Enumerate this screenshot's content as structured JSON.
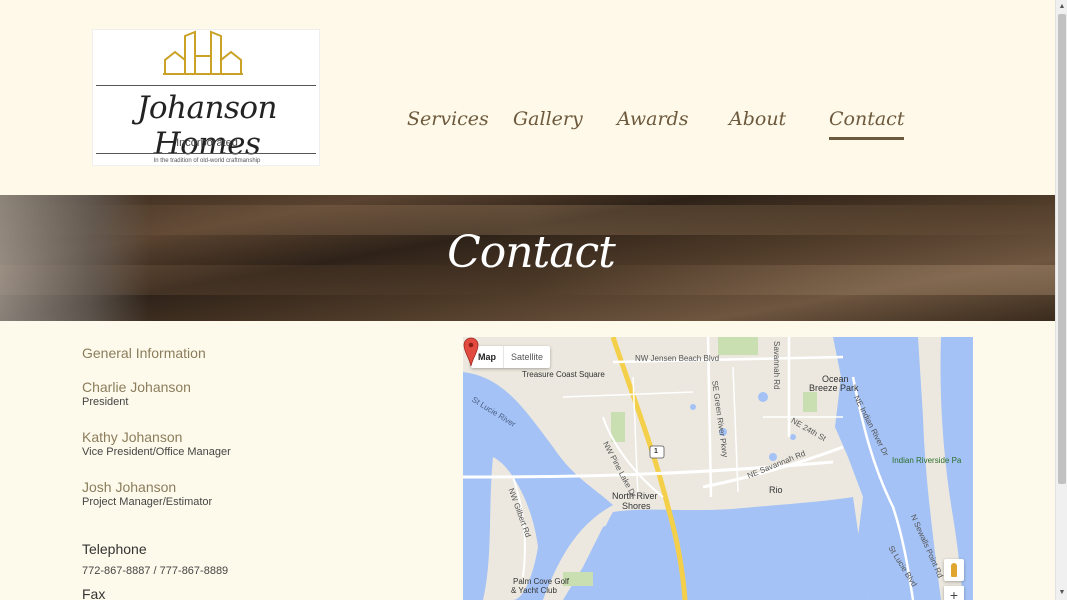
{
  "logo": {
    "brand": "Johanson Homes",
    "incorporated": "Incorporated",
    "tagline": "In the tradition of old-world craftmanship"
  },
  "nav": {
    "items": [
      {
        "label": "Services"
      },
      {
        "label": "Gallery"
      },
      {
        "label": "Awards"
      },
      {
        "label": "About"
      },
      {
        "label": "Contact",
        "active": true
      }
    ]
  },
  "banner": {
    "title": "Contact"
  },
  "contact": {
    "general_title": "General Information",
    "people": [
      {
        "name": "Charlie Johanson",
        "role": "President"
      },
      {
        "name": "Kathy Johanson",
        "role": "Vice President/Office Manager"
      },
      {
        "name": "Josh Johanson",
        "role": "Project Manager/Estimator"
      }
    ],
    "telephone_label": "Telephone",
    "telephone_value": "772-867-8887 / 777-867-8889",
    "fax_label": "Fax"
  },
  "map": {
    "type_map": "Map",
    "type_satellite": "Satellite",
    "labels": {
      "jensen": "NW Jensen Beach Blvd",
      "treasure": "Treasure Coast Square",
      "savannah_rd": "Savannah Rd",
      "ocean_breeze1": "Ocean",
      "ocean_breeze2": "Breeze Park",
      "st_lucie_river": "St Lucie River",
      "green_river": "SE Green River Pkwy",
      "ne_24th": "NE 24th St",
      "indian_river_dr": "NE Indian River Dr",
      "indian_riverside": "Indian Riverside Pa",
      "pine_lake": "NW Pine Lake Dr",
      "ne_savannah": "NE Savannah Rd",
      "rio": "Rio",
      "north_river1": "North River",
      "north_river2": "Shores",
      "gilbert": "NW Gilbert Rd",
      "sewalls": "N Sewalls Point Rd",
      "st_lucie_blvd": "St Lucie Blvd",
      "palm_cove1": "Palm Cove Golf",
      "palm_cove2": "& Yacht Club",
      "route": "1"
    },
    "zoom_in": "+"
  },
  "colors": {
    "background": "#fefaeb",
    "accent_brown": "#6d5a3e",
    "tan_text": "#8b7d5c",
    "logo_gold": "#c9a227"
  }
}
